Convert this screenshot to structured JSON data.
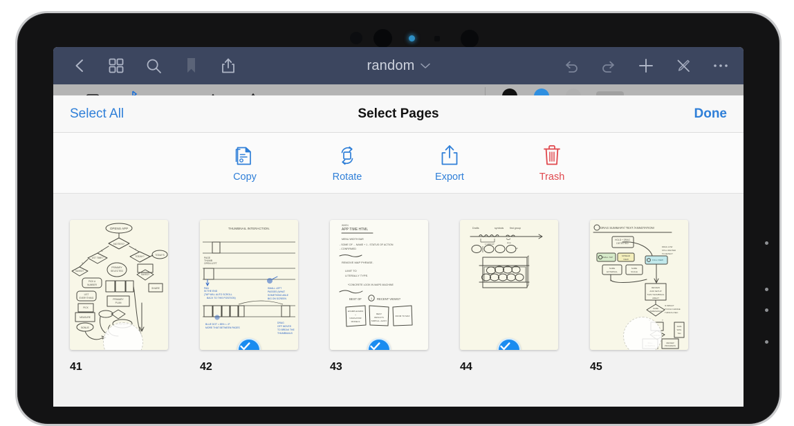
{
  "device": {
    "type": "tablet",
    "sensors": [
      "camera-dot",
      "camera-lens",
      "indicator-light",
      "sensor-square",
      "camera-lens-2"
    ],
    "indicator_color": "#2e8fc4"
  },
  "navbar": {
    "title": "random",
    "title_chevron": "chevron-down-icon",
    "background": "#3c465f",
    "left_items": [
      {
        "name": "back-button",
        "icon": "chevron-left-icon"
      },
      {
        "name": "grid-view-button",
        "icon": "grid-icon"
      },
      {
        "name": "search-button",
        "icon": "search-icon"
      },
      {
        "name": "bookmark-button",
        "icon": "bookmark-icon"
      },
      {
        "name": "share-button",
        "icon": "share-icon"
      }
    ],
    "right_items": [
      {
        "name": "undo-button",
        "icon": "undo-icon"
      },
      {
        "name": "redo-button",
        "icon": "redo-icon"
      },
      {
        "name": "add-page-button",
        "icon": "plus-icon"
      },
      {
        "name": "disable-pen-button",
        "icon": "pen-slash-icon"
      },
      {
        "name": "more-options-button",
        "icon": "ellipsis-icon"
      }
    ]
  },
  "tool_palette": {
    "visible": "partially-hidden-behind-sheet",
    "background": "#b4b4b4",
    "tools": [
      "eraser-tool",
      "bluetooth-pen-tool",
      "fountain-pen-tool",
      "pencil-tool",
      "marker-tool",
      "highlighter-tool",
      "lasso-tool",
      "shape-tool",
      "text-tool",
      "ruler-tool"
    ],
    "colors": [
      "#111111",
      "#2f8fe0",
      "#b0b0b0"
    ],
    "swatch_color": "#a0a0a0"
  },
  "sheet": {
    "title": "Select Pages",
    "select_all_label": "Select All",
    "done_label": "Done",
    "accent_color": "#2f7fd8",
    "actions": [
      {
        "label": "Copy",
        "icon": "copy-document-icon",
        "color": "#2f7fd8"
      },
      {
        "label": "Rotate",
        "icon": "rotate-icon",
        "color": "#2f7fd8"
      },
      {
        "label": "Export",
        "icon": "export-share-icon",
        "color": "#2f7fd8"
      },
      {
        "label": "Trash",
        "icon": "trash-icon",
        "color": "#e0474c"
      }
    ]
  },
  "pages": [
    {
      "number": "41",
      "selected": false,
      "paper": "cream",
      "content": "flowchart-sketch",
      "has_eraser_mark": true
    },
    {
      "number": "42",
      "selected": true,
      "paper": "cream",
      "content": "thumbnail-interaction-wireframe",
      "has_eraser_mark": false
    },
    {
      "number": "43",
      "selected": true,
      "paper": "white",
      "content": "handwritten-notes-with-cards",
      "has_eraser_mark": false
    },
    {
      "number": "44",
      "selected": true,
      "paper": "cream",
      "content": "timeline-with-circles",
      "has_eraser_mark": false
    },
    {
      "number": "45",
      "selected": false,
      "paper": "cream",
      "content": "highlighted-flowchart",
      "has_eraser_mark": true
    }
  ],
  "selection_badge": {
    "icon": "checkmark-icon",
    "fill": "#1a8cf0",
    "ring": "#d6ecfd"
  }
}
